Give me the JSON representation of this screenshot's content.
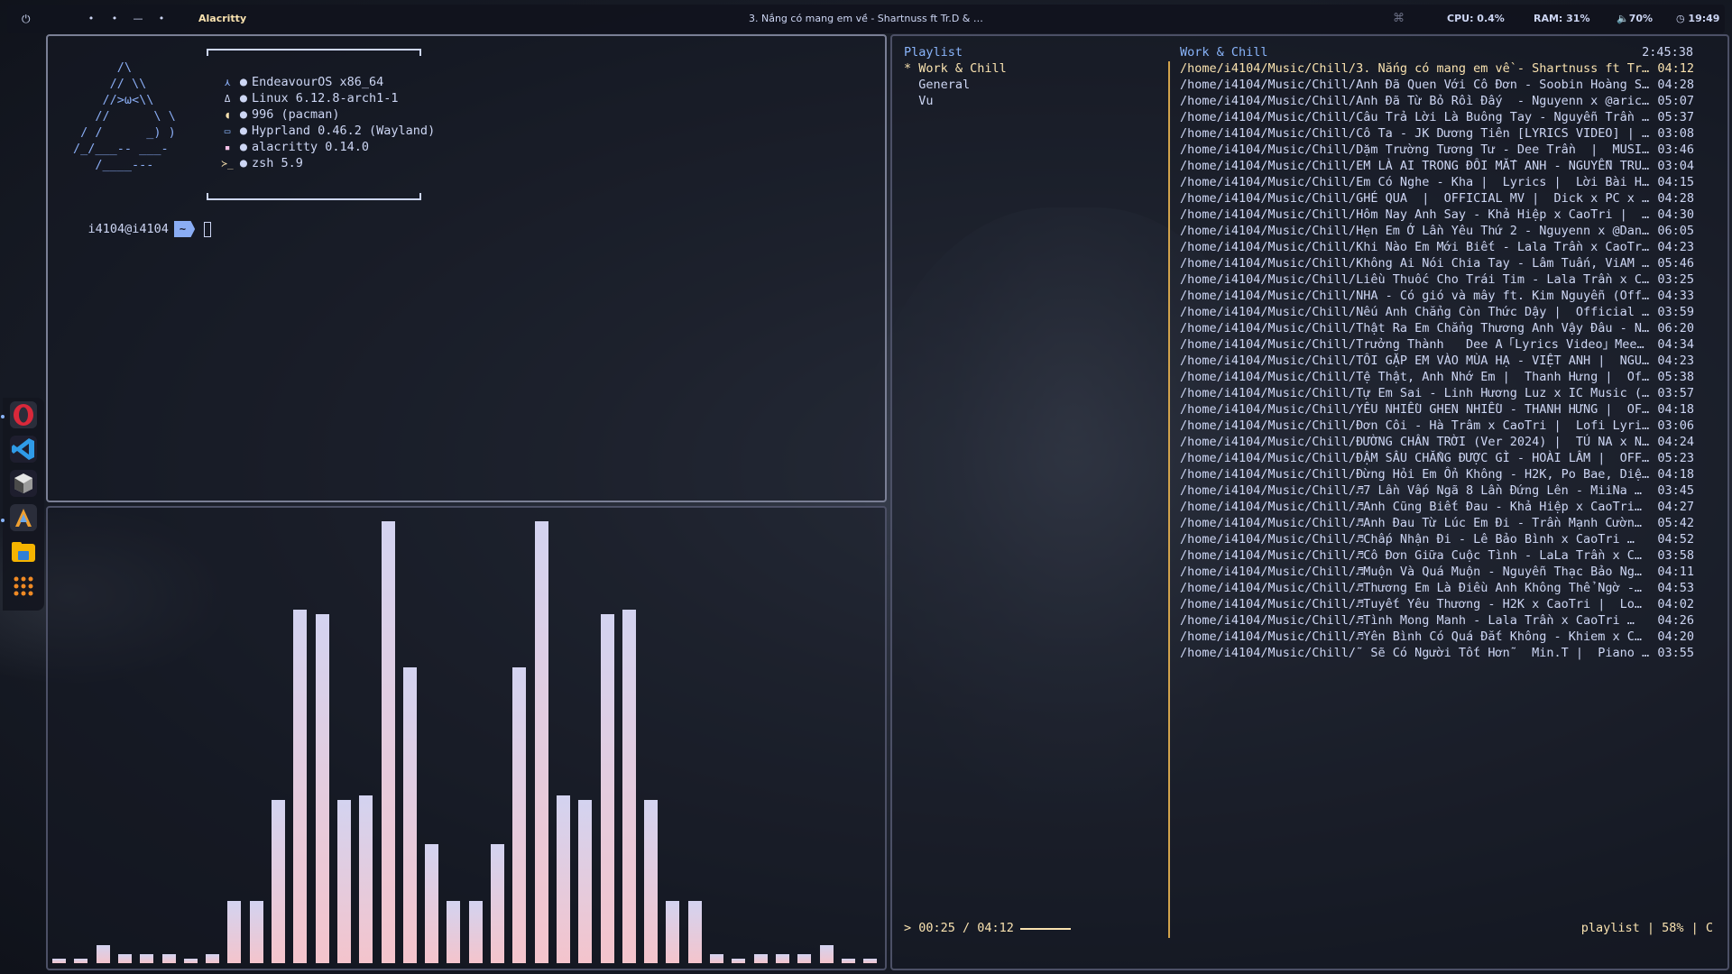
{
  "topbar": {
    "power_icon": "power-icon",
    "power_glyph": "⏻",
    "workspaces": [
      "•",
      "•",
      "—",
      "•"
    ],
    "app_name": "Alacritty",
    "window_title": "3. Nắng có mang em về - Shartnuss ft Tr.D & …",
    "tray_glyph": "⌘",
    "cpu": "CPU: 0.4%",
    "ram": "RAM: 31%",
    "volume": "🔈70%",
    "clock": "◷ 19:49"
  },
  "dock": {
    "apps": [
      {
        "name": "opera-icon",
        "color": "#d9283a"
      },
      {
        "name": "vscode-icon",
        "color": "#1e8ad6"
      },
      {
        "name": "app-cube-icon",
        "color": "#2b2b2b"
      },
      {
        "name": "arch-terminal-icon",
        "color": "#3a3f55"
      },
      {
        "name": "files-icon",
        "color": "#f5b400"
      },
      {
        "name": "app-grid-icon",
        "color": "#f08a24"
      }
    ]
  },
  "terminal": {
    "logo_lines": [
      "      /\\",
      "     // \\\\",
      "    //>ω<\\\\",
      "   //      \\ \\",
      " / /      _) )",
      "/_/___-- ___-",
      "   /____---"
    ],
    "info": [
      {
        "icon": "⋏",
        "icon_name": "endeavour-icon",
        "text": "EndeavourOS x86_64"
      },
      {
        "icon": "Δ",
        "icon_name": "linux-icon",
        "text": "Linux 6.12.8-arch1-1"
      },
      {
        "icon": "◖",
        "icon_name": "package-icon",
        "text": "996 (pacman)"
      },
      {
        "icon": "▭",
        "icon_name": "monitor-icon",
        "text": "Hyprland 0.46.2 (Wayland)"
      },
      {
        "icon": "▪",
        "icon_name": "terminal-app-icon",
        "text": "alacritty 0.14.0"
      },
      {
        "icon": "≻_",
        "icon_name": "shell-icon",
        "text": "zsh 5.9"
      }
    ],
    "bullet": "●",
    "prompt_user": "i4104@i4104",
    "prompt_dir": "~"
  },
  "visualizer": {
    "levels": [
      0.01,
      0.01,
      0.04,
      0.02,
      0.02,
      0.02,
      0.01,
      0.02,
      0.14,
      0.14,
      0.37,
      0.8,
      0.79,
      0.37,
      0.38,
      1.0,
      0.67,
      0.27,
      0.14,
      0.14,
      0.27,
      0.67,
      1.0,
      0.38,
      0.37,
      0.79,
      0.8,
      0.37,
      0.14,
      0.14,
      0.02,
      0.01,
      0.02,
      0.02,
      0.02,
      0.04,
      0.01,
      0.01
    ],
    "color_top": "#d3d3f0",
    "color_bottom": "#f4c4cc"
  },
  "player": {
    "playlist_title": "Playlist",
    "playlists": [
      {
        "label": "* Work & Chill",
        "active": true
      },
      {
        "label": "  General",
        "active": false
      },
      {
        "label": "  Vu",
        "active": false
      }
    ],
    "tracks_title": "Work & Chill",
    "total_time": "2:45:38",
    "tracks": [
      {
        "path": "/home/i4104/Music/Chill/3. Nắng có mang em về - Shartnuss ft Tr…",
        "dur": "04:12",
        "active": true
      },
      {
        "path": "/home/i4104/Music/Chill/Anh Đã Quen Với Cô Đơn - Soobin Hoàng S…",
        "dur": "04:28"
      },
      {
        "path": "/home/i4104/Music/Chill/Anh Đã Từ Bỏ Rồi Đấy  - Nguyenn x @aric…",
        "dur": "05:07"
      },
      {
        "path": "/home/i4104/Music/Chill/Câu Trả Lời Là Buông Tay - Nguyễn Trần …",
        "dur": "05:37"
      },
      {
        "path": "/home/i4104/Music/Chill/Cô Ta - JK Dương Tiên [LYRICS VIDEO] | …",
        "dur": "03:08"
      },
      {
        "path": "/home/i4104/Music/Chill/Dặm Trường Tương Tư - Dee Trần  |  MUSIC…",
        "dur": "03:46"
      },
      {
        "path": "/home/i4104/Music/Chill/EM LÀ AI TRONG ĐÔI MẮT ANH - NGUYỄN TRU…",
        "dur": "03:04"
      },
      {
        "path": "/home/i4104/Music/Chill/Em Có Nghe - Kha |  Lyrics |  Lời Bài H…",
        "dur": "04:15"
      },
      {
        "path": "/home/i4104/Music/Chill/GHÉ QUA  |  OFFICIAL MV |  Dick x PC x …",
        "dur": "04:28"
      },
      {
        "path": "/home/i4104/Music/Chill/Hôm Nay Anh Say - Khả Hiệp x CaoTri |  …",
        "dur": "04:30"
      },
      {
        "path": "/home/i4104/Music/Chill/Hẹn Em Ở Lần Yêu Thứ 2 - Nguyenn x @Dan…",
        "dur": "06:05"
      },
      {
        "path": "/home/i4104/Music/Chill/Khi Nào Em Mới Biết - Lala Trần x CaoTr…",
        "dur": "04:23"
      },
      {
        "path": "/home/i4104/Music/Chill/Không Ai Nói Chia Tay - Lâm Tuấn, ViAM …",
        "dur": "05:46"
      },
      {
        "path": "/home/i4104/Music/Chill/Liều Thuốc Cho Trái Tim - Lala Trần x C…",
        "dur": "03:25"
      },
      {
        "path": "/home/i4104/Music/Chill/NHA - Có gió và mây ft. Kim Nguyễn (Off…",
        "dur": "04:33"
      },
      {
        "path": "/home/i4104/Music/Chill/Nếu Anh Chẳng Còn Thức Dậy |  Official …",
        "dur": "03:59"
      },
      {
        "path": "/home/i4104/Music/Chill/Thật Ra Em Chẳng Thương Anh Vậy Đâu - N…",
        "dur": "06:20"
      },
      {
        "path": "/home/i4104/Music/Chill/Trưởng Thành   Dee A「Lyrics Video」Mee…",
        "dur": "04:34"
      },
      {
        "path": "/home/i4104/Music/Chill/TÔI GẶP EM VÀO MÙA HẠ - VIỆT ANH |  NGU…",
        "dur": "04:23"
      },
      {
        "path": "/home/i4104/Music/Chill/Tệ Thật, Anh Nhớ Em |  Thanh Hưng |  Of…",
        "dur": "05:38"
      },
      {
        "path": "/home/i4104/Music/Chill/Tự Em Sai - Linh Hương Luz x IC Music (…",
        "dur": "03:57"
      },
      {
        "path": "/home/i4104/Music/Chill/YÊU NHIỀU GHEN NHIỀU - THANH HƯNG |  OF…",
        "dur": "04:18"
      },
      {
        "path": "/home/i4104/Music/Chill/Đơn Côi - Hà Trâm x CaoTri |  Lofi Lyri…",
        "dur": "03:06"
      },
      {
        "path": "/home/i4104/Music/Chill/ĐƯỜNG CHÂN TRỜI (Ver 2024) |  TÚ NA x N…",
        "dur": "04:24"
      },
      {
        "path": "/home/i4104/Music/Chill/ĐẬM SÂU CHẲNG ĐƯỢC GÌ - HOÀI LÂM |  OFF…",
        "dur": "05:23"
      },
      {
        "path": "/home/i4104/Music/Chill/Đừng Hỏi Em Ổn Không - H2K, Po Bae, Diệ…",
        "dur": "04:18"
      },
      {
        "path": "/home/i4104/Music/Chill/♬7 Lần Vấp Ngã 8 Lần Đứng Lên - MiiNa …",
        "dur": "03:45"
      },
      {
        "path": "/home/i4104/Music/Chill/♬Anh Cũng Biết Đau - Khả Hiệp x CaoTri…",
        "dur": "04:27"
      },
      {
        "path": "/home/i4104/Music/Chill/♬Anh Đau Từ Lúc Em Đi - Trần Mạnh Cườn…",
        "dur": "05:42"
      },
      {
        "path": "/home/i4104/Music/Chill/♬Chấp Nhận Đi - Lê Bảo Bình x CaoTri …",
        "dur": "04:52"
      },
      {
        "path": "/home/i4104/Music/Chill/♬Cô Đơn Giữa Cuộc Tình - LaLa Trần x C…",
        "dur": "03:58"
      },
      {
        "path": "/home/i4104/Music/Chill/♬Muộn Và Quá Muộn - Nguyễn Thạc Bảo Ng…",
        "dur": "04:11"
      },
      {
        "path": "/home/i4104/Music/Chill/♬Thương Em Là Điều Anh Không Thể Ngờ -…",
        "dur": "04:53"
      },
      {
        "path": "/home/i4104/Music/Chill/♬Tuyết Yêu Thương - H2K x CaoTri |  Lo…",
        "dur": "04:02"
      },
      {
        "path": "/home/i4104/Music/Chill/♬Tình Mong Manh - Lala Trần x CaoTri …",
        "dur": "04:26"
      },
      {
        "path": "/home/i4104/Music/Chill/♬Yên Bình Có Quá Đắt Không - Khiem x C…",
        "dur": "04:20"
      },
      {
        "path": "/home/i4104/Music/Chill/˜ Sẽ Có Người Tốt Hơn˜  Min.T |  Piano …",
        "dur": "03:55"
      }
    ],
    "progress_text": "> 00:25 / 04:12",
    "progress_fraction": 0.1,
    "status_right": "playlist | 58% | C"
  }
}
